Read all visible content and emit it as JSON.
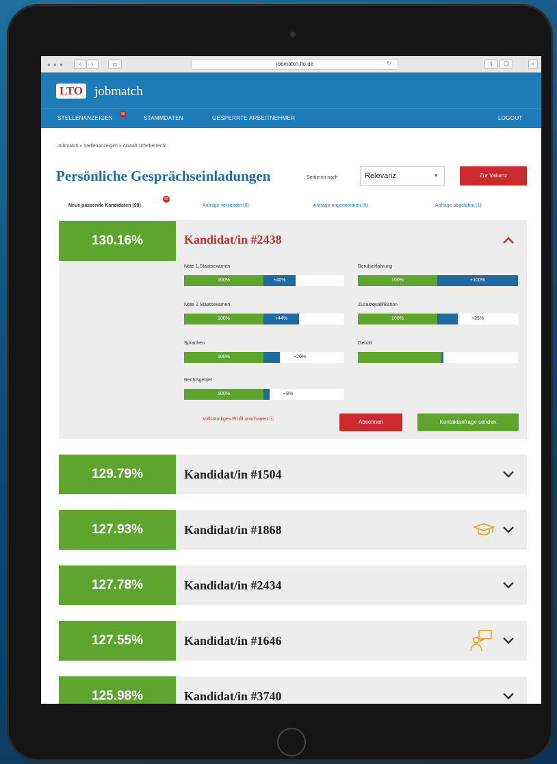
{
  "browser": {
    "url": "jobmatch.lto.de"
  },
  "header": {
    "logo": "LTO",
    "app_name": "jobmatch"
  },
  "nav": {
    "items": [
      "STELLENANZEIGEN",
      "STAMMDATEN",
      "GESPERRTE ARBEITNEHMER"
    ],
    "badge": "99",
    "logout": "LOGOUT"
  },
  "breadcrumb": "Jobmatch » Stellenanzeigen » Anwalt Urheberrecht",
  "page": {
    "title": "Persönliche Gesprächseinladungen",
    "sort_label": "Sortieren nach",
    "sort_value": "Relevanz",
    "vacancy_button": "Zur Vakanz"
  },
  "tabs": [
    {
      "label": "Neue passende Kandidaten (99)",
      "badge": "99"
    },
    {
      "label": "Anfrage versendet (0)"
    },
    {
      "label": "Anfrage angenommen (0)"
    },
    {
      "label": "Anfrage abgelehnt (1)"
    }
  ],
  "expanded": {
    "score": "130.16%",
    "title": "Kandidat/in #2438",
    "criteria": [
      {
        "label": "Note 1.Staatsexamen",
        "base": "100%",
        "extra": "+40%",
        "extra_fraction": 0.4
      },
      {
        "label": "Berufserfahrung",
        "base": "100%",
        "extra": "+100%",
        "extra_fraction": 1.0
      },
      {
        "label": "Note 2.Staatsexamen",
        "base": "100%",
        "extra": "+44%",
        "extra_fraction": 0.44
      },
      {
        "label": "Zusatzqualifikation",
        "base": "100%",
        "extra": "+25%",
        "extra_fraction": 0.25
      },
      {
        "label": "Sprachen",
        "base": "100%",
        "extra": "+20%",
        "extra_fraction": 0.2
      },
      {
        "label": "Gehalt",
        "base": "",
        "extra": "",
        "fill_fraction": 0.52
      },
      {
        "label": "Rechtsgebiet",
        "base": "100%",
        "extra": "+8%",
        "extra_fraction": 0.08
      }
    ],
    "profile_link": "Vollständiges Profil anschauen",
    "reject_button": "Absehnen",
    "contact_button": "Kontaktanfrage senden"
  },
  "candidates": [
    {
      "score": "129.79%",
      "title": "Kandidat/in #1504",
      "icon": ""
    },
    {
      "score": "127.93%",
      "title": "Kandidat/in #1868",
      "icon": "graduation-cap-icon"
    },
    {
      "score": "127.78%",
      "title": "Kandidat/in #2434",
      "icon": ""
    },
    {
      "score": "127.55%",
      "title": "Kandidat/in #1646",
      "icon": "speech-person-icon"
    },
    {
      "score": "125.98%",
      "title": "Kandidat/in #3740",
      "icon": ""
    }
  ],
  "colors": {
    "primary": "#1f7bb8",
    "green": "#5ea530",
    "red": "#cc2a2e",
    "blue": "#1f6aa3",
    "amber": "#e0a21f"
  }
}
